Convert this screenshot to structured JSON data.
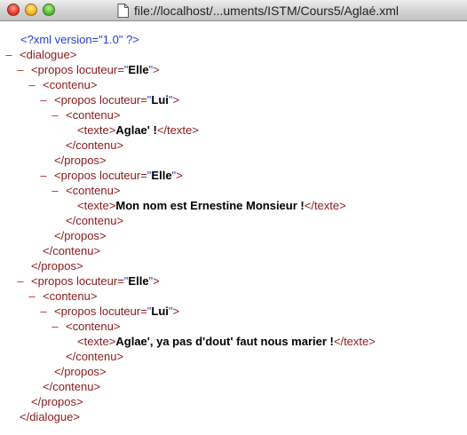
{
  "window": {
    "title": "file://localhost/...uments/ISTM/Cours5/Aglaé.xml"
  },
  "xml": {
    "declaration": "<?xml version=\"1.0\" ?>",
    "toggle_symbol": "–",
    "lines": [
      {
        "toggle": "–",
        "parts": [
          [
            "tag",
            "<dialogue>"
          ]
        ]
      },
      {
        "toggle": "–",
        "parts": [
          [
            "tag",
            "<propos "
          ],
          [
            "tag",
            "locuteur="
          ],
          [
            "quote",
            "\""
          ],
          [
            "val",
            "Elle"
          ],
          [
            "quote",
            "\""
          ],
          [
            "tag",
            ">"
          ]
        ]
      },
      {
        "toggle": "–",
        "parts": [
          [
            "tag",
            "<contenu>"
          ]
        ]
      },
      {
        "toggle": "–",
        "parts": [
          [
            "tag",
            "<propos "
          ],
          [
            "tag",
            "locuteur="
          ],
          [
            "quote",
            "\""
          ],
          [
            "val",
            "Lui"
          ],
          [
            "quote",
            "\""
          ],
          [
            "tag",
            ">"
          ]
        ]
      },
      {
        "toggle": "–",
        "parts": [
          [
            "tag",
            "<contenu>"
          ]
        ]
      },
      {
        "toggle": "",
        "parts": [
          [
            "tag",
            "<texte>"
          ],
          [
            "text",
            "Aglae' !"
          ],
          [
            "tag",
            "</texte>"
          ]
        ]
      },
      {
        "toggle": "",
        "parts": [
          [
            "tag",
            "</contenu>"
          ]
        ]
      },
      {
        "toggle": "",
        "parts": [
          [
            "tag",
            "</propos>"
          ]
        ]
      },
      {
        "toggle": "–",
        "parts": [
          [
            "tag",
            "<propos "
          ],
          [
            "tag",
            "locuteur="
          ],
          [
            "quote",
            "\""
          ],
          [
            "val",
            "Elle"
          ],
          [
            "quote",
            "\""
          ],
          [
            "tag",
            ">"
          ]
        ]
      },
      {
        "toggle": "–",
        "parts": [
          [
            "tag",
            "<contenu>"
          ]
        ]
      },
      {
        "toggle": "",
        "parts": [
          [
            "tag",
            "<texte>"
          ],
          [
            "text",
            "Mon nom est Ernestine Monsieur !"
          ],
          [
            "tag",
            "</texte>"
          ]
        ]
      },
      {
        "toggle": "",
        "parts": [
          [
            "tag",
            "</contenu>"
          ]
        ]
      },
      {
        "toggle": "",
        "parts": [
          [
            "tag",
            "</propos>"
          ]
        ]
      },
      {
        "toggle": "",
        "parts": [
          [
            "tag",
            "</contenu>"
          ]
        ]
      },
      {
        "toggle": "",
        "parts": [
          [
            "tag",
            "</propos>"
          ]
        ]
      },
      {
        "toggle": "–",
        "parts": [
          [
            "tag",
            "<propos "
          ],
          [
            "tag",
            "locuteur="
          ],
          [
            "quote",
            "\""
          ],
          [
            "val",
            "Elle"
          ],
          [
            "quote",
            "\""
          ],
          [
            "tag",
            ">"
          ]
        ]
      },
      {
        "toggle": "–",
        "parts": [
          [
            "tag",
            "<contenu>"
          ]
        ]
      },
      {
        "toggle": "–",
        "parts": [
          [
            "tag",
            "<propos "
          ],
          [
            "tag",
            "locuteur="
          ],
          [
            "quote",
            "\""
          ],
          [
            "val",
            "Lui"
          ],
          [
            "quote",
            "\""
          ],
          [
            "tag",
            ">"
          ]
        ]
      },
      {
        "toggle": "–",
        "parts": [
          [
            "tag",
            "<contenu>"
          ]
        ]
      },
      {
        "toggle": "",
        "parts": [
          [
            "tag",
            "<texte>"
          ],
          [
            "text",
            "Aglae', ya pas d'dout' faut nous marier !"
          ],
          [
            "tag",
            "</texte>"
          ]
        ]
      },
      {
        "toggle": "",
        "parts": [
          [
            "tag",
            "</contenu>"
          ]
        ]
      },
      {
        "toggle": "",
        "parts": [
          [
            "tag",
            "</propos>"
          ]
        ]
      },
      {
        "toggle": "",
        "parts": [
          [
            "tag",
            "</contenu>"
          ]
        ]
      },
      {
        "toggle": "",
        "parts": [
          [
            "tag",
            "</propos>"
          ]
        ]
      },
      {
        "toggle": "",
        "parts": [
          [
            "tag",
            "</dialogue>"
          ]
        ]
      }
    ]
  }
}
